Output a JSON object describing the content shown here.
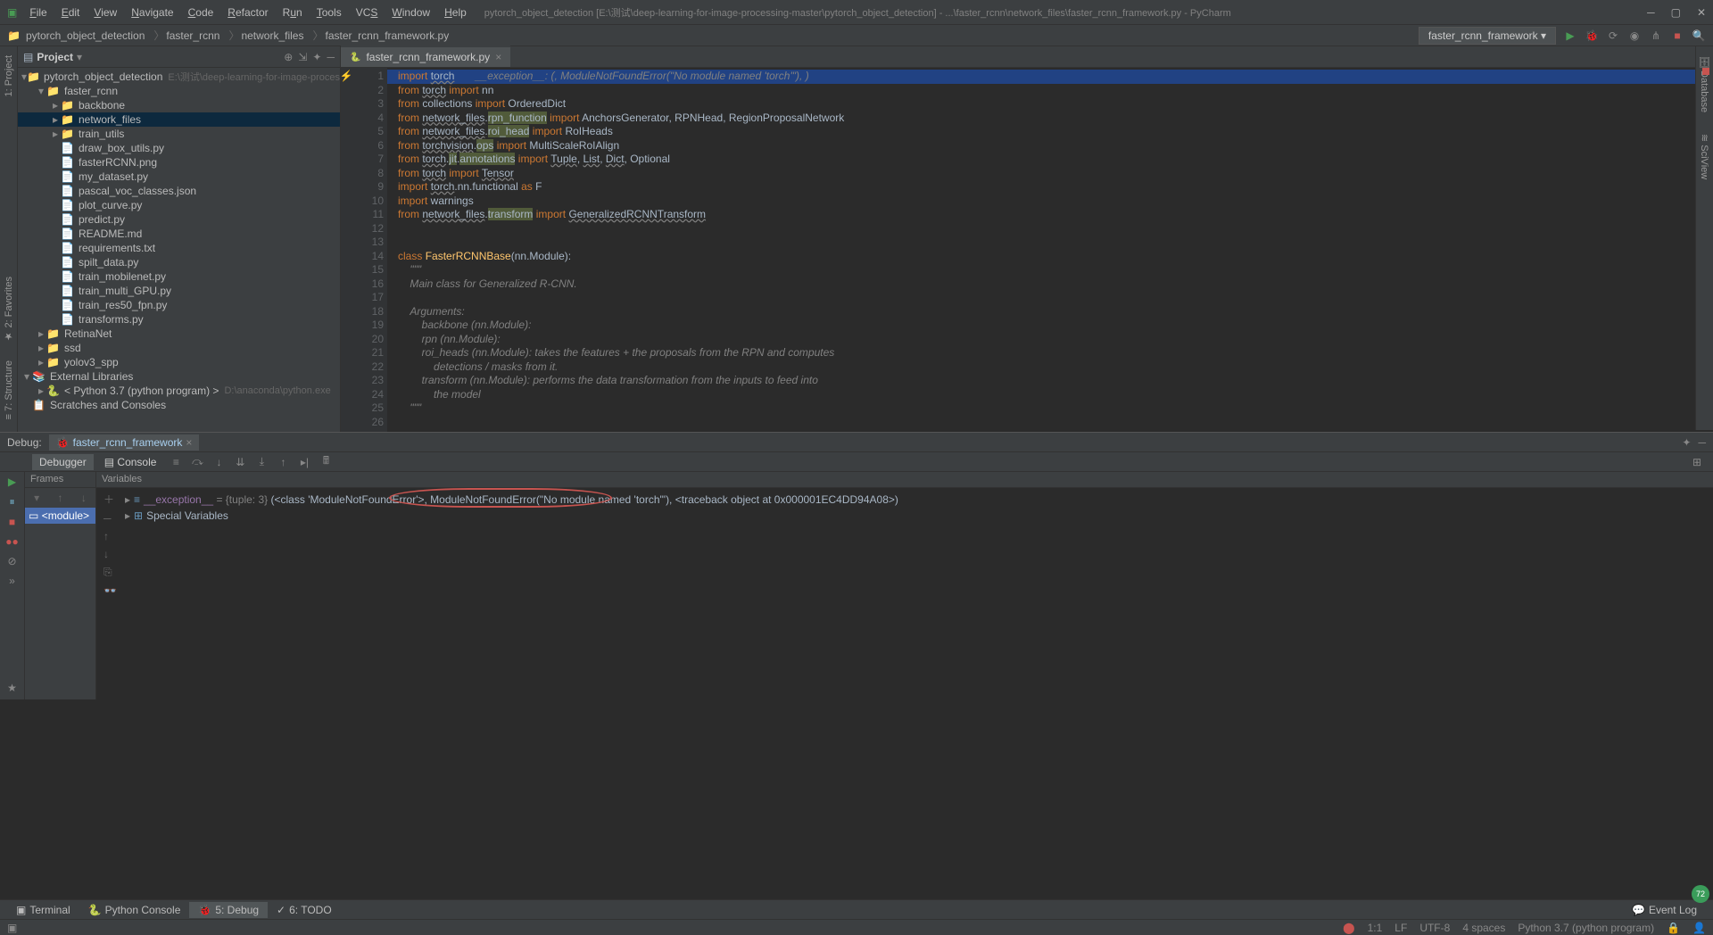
{
  "title": "pytorch_object_detection [E:\\测试\\deep-learning-for-image-processing-master\\pytorch_object_detection] - ...\\faster_rcnn\\network_files\\faster_rcnn_framework.py - PyCharm",
  "menu": [
    "File",
    "Edit",
    "View",
    "Navigate",
    "Code",
    "Refactor",
    "Run",
    "Tools",
    "VCS",
    "Window",
    "Help"
  ],
  "breadcrumbs": [
    "pytorch_object_detection",
    "faster_rcnn",
    "network_files",
    "faster_rcnn_framework.py"
  ],
  "run_config": "faster_rcnn_framework",
  "project_panel": {
    "title": "Project"
  },
  "tree": [
    {
      "d": 0,
      "a": "▾",
      "i": "📁",
      "t": "pytorch_object_detection",
      "x": "E:\\测试\\deep-learning-for-image-processing-m"
    },
    {
      "d": 1,
      "a": "▾",
      "i": "📁",
      "t": "faster_rcnn"
    },
    {
      "d": 2,
      "a": "▸",
      "i": "📁",
      "t": "backbone"
    },
    {
      "d": 2,
      "a": "▸",
      "i": "📁",
      "t": "network_files",
      "sel": true
    },
    {
      "d": 2,
      "a": "▸",
      "i": "📁",
      "t": "train_utils"
    },
    {
      "d": 2,
      "a": "",
      "i": "📄",
      "t": "draw_box_utils.py"
    },
    {
      "d": 2,
      "a": "",
      "i": "📄",
      "t": "fasterRCNN.png"
    },
    {
      "d": 2,
      "a": "",
      "i": "📄",
      "t": "my_dataset.py"
    },
    {
      "d": 2,
      "a": "",
      "i": "📄",
      "t": "pascal_voc_classes.json"
    },
    {
      "d": 2,
      "a": "",
      "i": "📄",
      "t": "plot_curve.py"
    },
    {
      "d": 2,
      "a": "",
      "i": "📄",
      "t": "predict.py"
    },
    {
      "d": 2,
      "a": "",
      "i": "📄",
      "t": "README.md"
    },
    {
      "d": 2,
      "a": "",
      "i": "📄",
      "t": "requirements.txt"
    },
    {
      "d": 2,
      "a": "",
      "i": "📄",
      "t": "spilt_data.py"
    },
    {
      "d": 2,
      "a": "",
      "i": "📄",
      "t": "train_mobilenet.py"
    },
    {
      "d": 2,
      "a": "",
      "i": "📄",
      "t": "train_multi_GPU.py"
    },
    {
      "d": 2,
      "a": "",
      "i": "📄",
      "t": "train_res50_fpn.py"
    },
    {
      "d": 2,
      "a": "",
      "i": "📄",
      "t": "transforms.py"
    },
    {
      "d": 1,
      "a": "▸",
      "i": "📁",
      "t": "RetinaNet"
    },
    {
      "d": 1,
      "a": "▸",
      "i": "📁",
      "t": "ssd"
    },
    {
      "d": 1,
      "a": "▸",
      "i": "📁",
      "t": "yolov3_spp"
    },
    {
      "d": 0,
      "a": "▾",
      "i": "📚",
      "t": "External Libraries"
    },
    {
      "d": 1,
      "a": "▸",
      "i": "🐍",
      "t": "< Python 3.7 (python program) >",
      "x": "D:\\anaconda\\python.exe"
    },
    {
      "d": 0,
      "a": "",
      "i": "📋",
      "t": "Scratches and Consoles"
    }
  ],
  "editor_tab": "faster_rcnn_framework.py",
  "exception_inline": "__exception__: (<class 'ModuleNotFoundError'>, ModuleNotFoundError(\"No module named 'torch'\"), <traceback object at 0x000001EC4DD94A08>)",
  "code": {
    "lines": 26
  },
  "debug": {
    "label": "Debug:",
    "tab": "faster_rcnn_framework",
    "tabs": [
      "Debugger",
      "Console"
    ],
    "frames_title": "Frames",
    "vars_title": "Variables",
    "frame_item": "<module>",
    "var_exception": "__exception__",
    "var_exception_type": "= {tuple: 3}",
    "var_exception_val": "(<class 'ModuleNotFoundError'>, ModuleNotFoundError(\"No module named 'torch'\"), <traceback object at 0x000001EC4DD94A08>)",
    "special_vars": "Special Variables"
  },
  "bottom_tabs": [
    "Terminal",
    "Python Console",
    "5: Debug",
    "6: TODO"
  ],
  "event_log": "Event Log",
  "status": {
    "pos": "1:1",
    "enc": "LF",
    "charset": "UTF-8",
    "indent": "4 spaces",
    "interp": "Python 3.7 (python program)"
  }
}
